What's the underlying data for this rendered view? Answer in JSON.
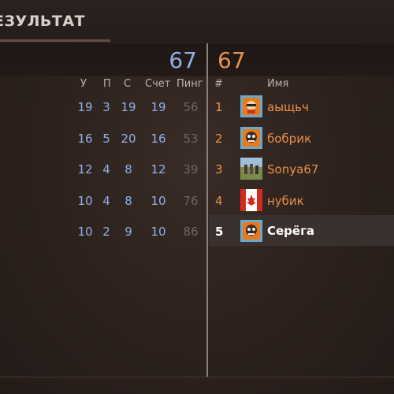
{
  "header": {
    "title": "ЕЗУЛЬТАТ"
  },
  "scores": {
    "left": "67",
    "right": "67"
  },
  "columns_left": [
    "У",
    "П",
    "С",
    "Счет",
    "Пинг"
  ],
  "columns_right": {
    "rank": "#",
    "name": "Имя"
  },
  "rows": [
    {
      "u": "19",
      "p": "3",
      "s": "19",
      "score": "19",
      "ping": "56",
      "rank": "1",
      "name": "аыщьч",
      "avatar": "orange-character-avatar"
    },
    {
      "u": "16",
      "p": "5",
      "s": "20",
      "score": "16",
      "ping": "53",
      "rank": "2",
      "name": "бобрик",
      "avatar": "orange-character-avatar"
    },
    {
      "u": "12",
      "p": "4",
      "s": "8",
      "score": "12",
      "ping": "39",
      "rank": "3",
      "name": "Sonya67",
      "avatar": "photo-avatar"
    },
    {
      "u": "10",
      "p": "4",
      "s": "8",
      "score": "10",
      "ping": "76",
      "rank": "4",
      "name": "нубик",
      "avatar": "canada-flag-avatar"
    },
    {
      "u": "10",
      "p": "2",
      "s": "9",
      "score": "10",
      "ping": "86",
      "rank": "5",
      "name": "Серёга",
      "avatar": "orange-character-avatar",
      "highlighted": true
    }
  ],
  "colors": {
    "blue_team": "#8fb0ea",
    "orange_team": "#e8924a"
  }
}
